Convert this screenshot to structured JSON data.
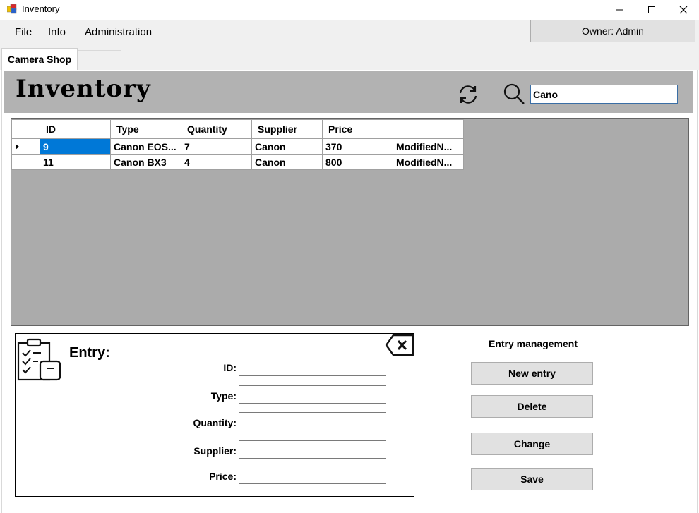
{
  "window": {
    "title": "Inventory"
  },
  "menu": {
    "file": "File",
    "info": "Info",
    "administration": "Administration"
  },
  "owner": {
    "label": "Owner: Admin"
  },
  "tabs": {
    "active": "Camera Shop",
    "second": ""
  },
  "header": {
    "title": "Inventory",
    "search_value": "Cano"
  },
  "grid": {
    "columns": [
      "ID",
      "Type",
      "Quantity",
      "Supplier",
      "Price",
      ""
    ],
    "rows": [
      {
        "id": "9",
        "type": "Canon EOS...",
        "quantity": "7",
        "supplier": "Canon",
        "price": "370",
        "extra": "ModifiedN..."
      },
      {
        "id": "11",
        "type": "Canon BX3",
        "quantity": "4",
        "supplier": "Canon",
        "price": "800",
        "extra": "ModifiedN..."
      }
    ],
    "selected_row": 0
  },
  "entry": {
    "title": "Entry:",
    "labels": {
      "id": "ID:",
      "type": "Type:",
      "quantity": "Quantity:",
      "supplier": "Supplier:",
      "price": "Price:"
    },
    "values": {
      "id": "",
      "type": "",
      "quantity": "",
      "supplier": "",
      "price": ""
    }
  },
  "management": {
    "title": "Entry management",
    "new_entry": "New entry",
    "delete": "Delete",
    "change": "Change",
    "save": "Save"
  },
  "colors": {
    "header_band": "#b2b2b2",
    "grid_background": "#ababab",
    "selection": "#0078d7"
  }
}
